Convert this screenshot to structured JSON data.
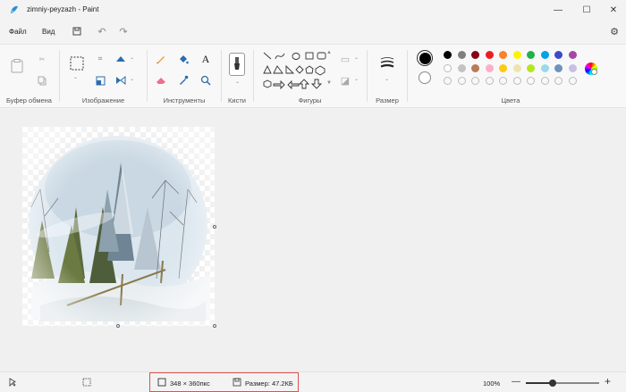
{
  "window": {
    "title": "zimniy-peyzazh - Paint"
  },
  "menu": {
    "file": "Файл",
    "view": "Вид"
  },
  "ribbon": {
    "groups": {
      "clipboard": "Буфер обмена",
      "image": "Изображение",
      "tools": "Инструменты",
      "brushes": "Кисти",
      "shapes": "Фигуры",
      "size": "Размер",
      "colors": "Цвета"
    },
    "palette": {
      "row1": [
        "#000000",
        "#7f7f7f",
        "#880015",
        "#ed1c24",
        "#ff7f27",
        "#fff200",
        "#22b14c",
        "#00a2e8",
        "#3f48cc",
        "#a349a4"
      ],
      "row2": [
        "#ffffff",
        "#c3c3c3",
        "#b97a57",
        "#ffaec9",
        "#ffc90e",
        "#efe4b0",
        "#b5e61d",
        "#99d9ea",
        "#7092be",
        "#c8bfe7"
      ]
    },
    "primary_color": "#000000",
    "secondary_color": "#ffffff"
  },
  "status": {
    "dimensions": "348 × 360пкс",
    "size": "Размер: 47.2КБ",
    "zoom": "100%"
  }
}
